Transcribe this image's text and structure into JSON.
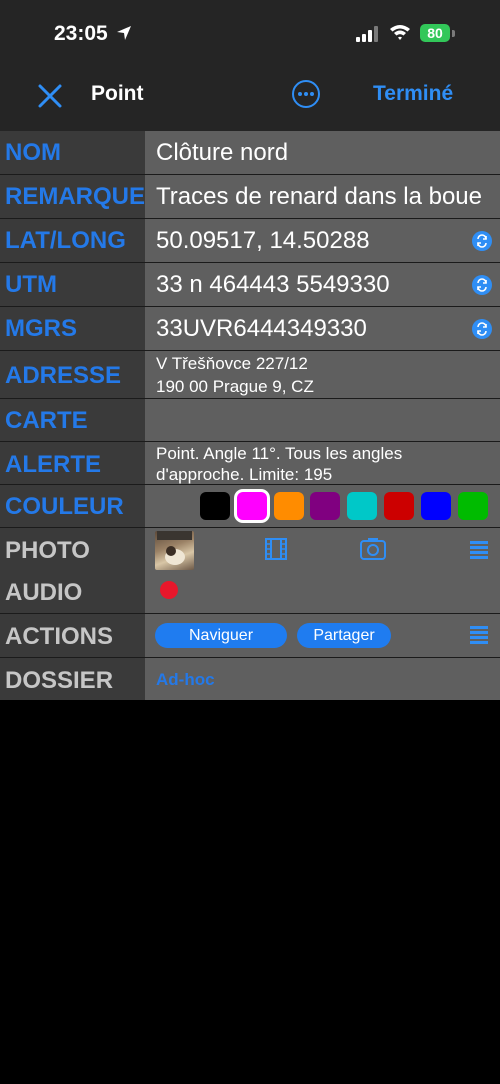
{
  "status": {
    "time": "23:05",
    "battery": "80"
  },
  "nav": {
    "title": "Point",
    "done": "Terminé"
  },
  "rows": {
    "nom": {
      "label": "NOM",
      "value": "Clôture nord"
    },
    "remarque": {
      "label": "REMARQUE",
      "value": "Traces de renard dans la boue"
    },
    "latlong": {
      "label": "LAT/LONG",
      "value": "50.09517, 14.50288"
    },
    "utm": {
      "label": "UTM",
      "value": "33 n 464443 5549330"
    },
    "mgrs": {
      "label": "MGRS",
      "value": "33UVR6444349330"
    },
    "adresse": {
      "label": "ADRESSE",
      "line1": "V Třešňovce 227/12",
      "line2": "190 00 Prague 9, CZ"
    },
    "carte": {
      "label": "CARTE",
      "value": ""
    },
    "alerte": {
      "label": "ALERTE",
      "line1": "Point. Angle 11°.  Tous les angles",
      "line2": "d'approche. Limite: 195"
    },
    "couleur": {
      "label": "COULEUR",
      "colors": [
        "#000000",
        "#ff00ff",
        "#ff8c00",
        "#800080",
        "#00c8c8",
        "#cc0000",
        "#0000ff",
        "#00bb00"
      ],
      "selected": 1
    },
    "photo": {
      "label": "PHOTO"
    },
    "audio": {
      "label": "AUDIO"
    },
    "actions": {
      "label": "ACTIONS",
      "navigate": "Naviguer",
      "share": "Partager"
    },
    "dossier": {
      "label": "DOSSIER",
      "value": "Ad-hoc"
    }
  }
}
